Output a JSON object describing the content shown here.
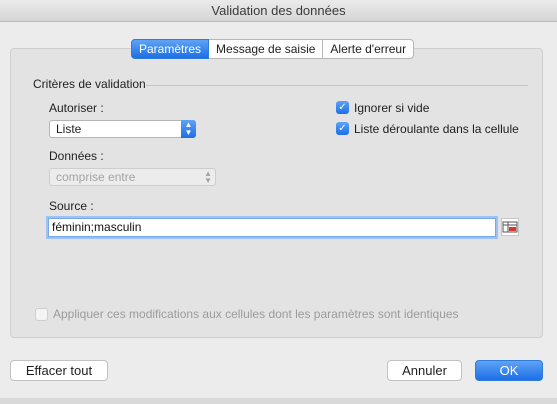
{
  "window": {
    "title": "Validation des données"
  },
  "tabs": [
    {
      "label": "Paramètres",
      "active": true
    },
    {
      "label": "Message de saisie",
      "active": false
    },
    {
      "label": "Alerte d'erreur",
      "active": false
    }
  ],
  "criteria": {
    "section_title": "Critères de validation",
    "allow_label": "Autoriser :",
    "allow_value": "Liste",
    "data_label": "Données :",
    "data_value": "comprise entre",
    "ignore_blank": {
      "label": "Ignorer si vide",
      "checked": true
    },
    "in_cell_dropdown": {
      "label": "Liste déroulante dans la cellule",
      "checked": true
    },
    "source_label": "Source :",
    "source_value": "féminin;masculin"
  },
  "apply_all": {
    "label": "Appliquer ces modifications aux cellules dont les paramètres sont identiques",
    "checked": false,
    "enabled": false
  },
  "buttons": {
    "clear_all": "Effacer tout",
    "cancel": "Annuler",
    "ok": "OK"
  },
  "colors": {
    "accent": "#1c6fe6",
    "window_bg": "#ececec",
    "panel_bg": "#e3e3e3"
  }
}
